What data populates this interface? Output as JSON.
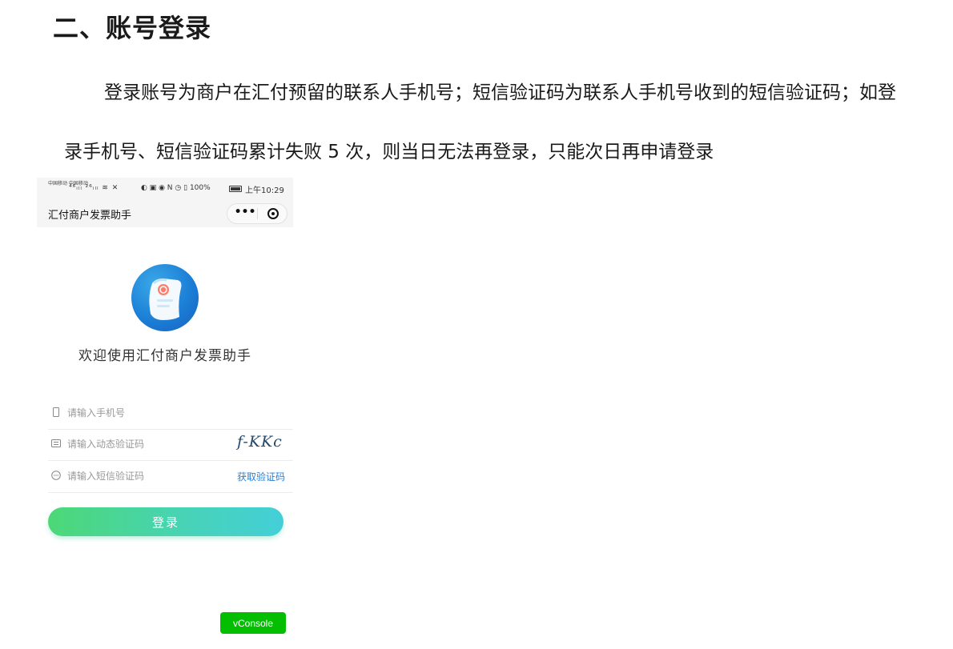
{
  "document": {
    "heading": "二、账号登录",
    "paragraph_line1": "登录账号为商户在汇付预留的联系人手机号；短信验证码为联系人手机号收到的短信验证码；如登",
    "paragraph_line2": "录手机号、短信验证码累计失败 5 次，则当日无法再登录，只能次日再申请登录"
  },
  "phone": {
    "status_bar": {
      "carrier": "中国移动 中国移动",
      "signal_text": "⁴⁶ᵢₗₗ ²⁶ᵢₗₗ ≋ ✕",
      "status_icons_text": "◐ ▣ ◉ N ◷ ▯",
      "battery": "100%",
      "time": "上午10:29"
    },
    "nav": {
      "title": "汇付商户发票助手",
      "more_label": "•••"
    },
    "welcome_text": "欢迎使用汇付商户发票助手",
    "form": {
      "phone_placeholder": "请输入手机号",
      "captcha_placeholder": "请输入动态验证码",
      "captcha_image_text": "f-KKc",
      "sms_placeholder": "请输入短信验证码",
      "get_code_label": "获取验证码"
    },
    "login_button": "登录",
    "vconsole_button": "vConsole",
    "icons": [
      "phone-icon",
      "captcha-icon",
      "message-icon",
      "logo-icon",
      "more-icon",
      "target-icon",
      "battery-icon"
    ],
    "colors": {
      "link_blue": "#2a7fd1",
      "button_gradient_start": "#4cd876",
      "button_gradient_end": "#44cfd8",
      "vconsole_green": "#04be02",
      "logo_blue": "#1c7fd6"
    }
  }
}
